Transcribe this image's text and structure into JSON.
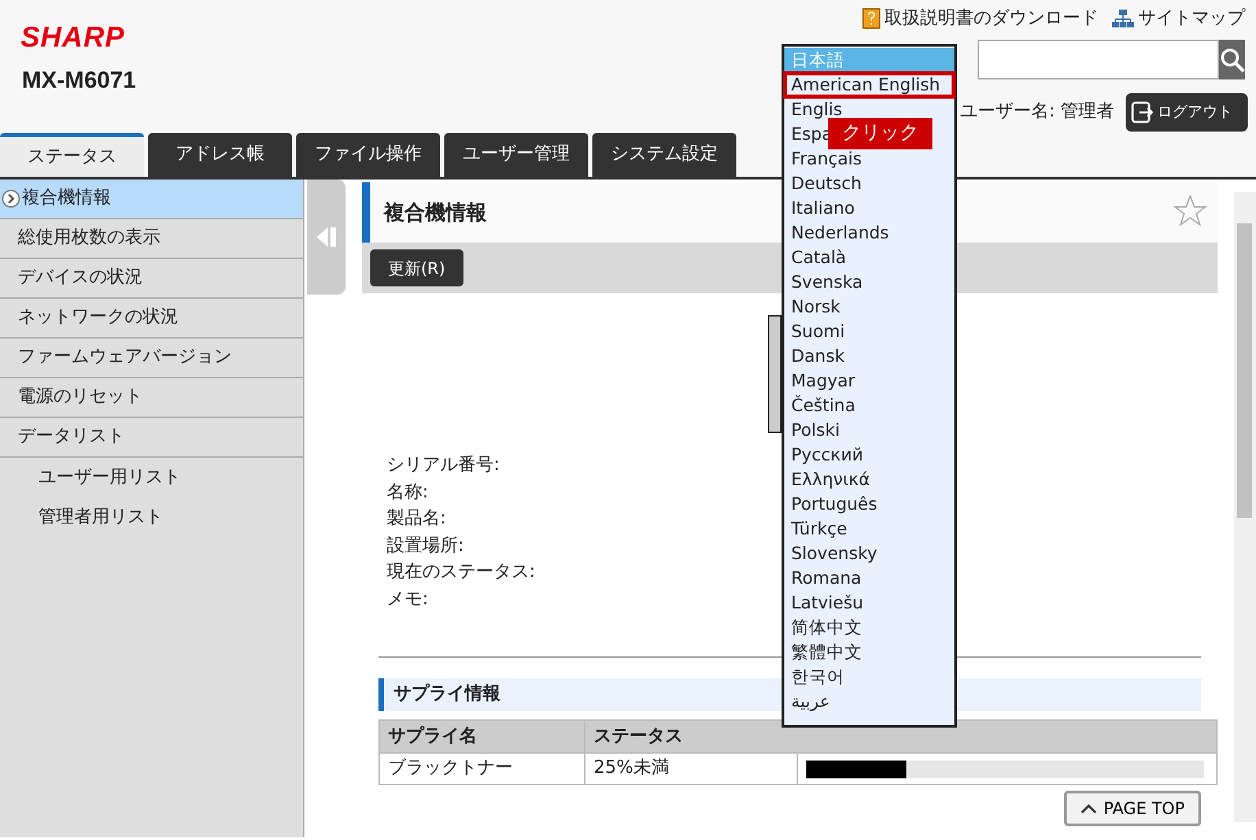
{
  "header": {
    "logo": "SHARP",
    "model": "MX-M6071",
    "links": [
      {
        "kind": "manual",
        "label": "取扱説明書のダウンロード"
      },
      {
        "kind": "sitemap",
        "label": "サイトマップ"
      }
    ],
    "user": "ユーザー名: 管理者",
    "logout": "ログアウト"
  },
  "tabs": [
    {
      "label": "ステータス",
      "selected": true
    },
    {
      "label": "アドレス帳",
      "selected": false
    },
    {
      "label": "ファイル操作",
      "selected": false
    },
    {
      "label": "ユーザー管理",
      "selected": false
    },
    {
      "label": "システム設定",
      "selected": false
    }
  ],
  "sidebar": {
    "items": [
      {
        "label": "複合機情報",
        "selected": true
      },
      {
        "label": "総使用枚数の表示",
        "selected": false
      },
      {
        "label": "デバイスの状況",
        "selected": false
      },
      {
        "label": "ネットワークの状況",
        "selected": false
      },
      {
        "label": "ファームウェアバージョン",
        "selected": false
      },
      {
        "label": "電源のリセット",
        "selected": false
      },
      {
        "label": "データリスト",
        "selected": false,
        "children": [
          {
            "label": "ユーザー用リスト",
            "selected": false
          },
          {
            "label": "管理者用リスト",
            "selected": false
          }
        ]
      }
    ]
  },
  "main": {
    "title": "複合機情報",
    "refresh_button": "更新(R)",
    "fields": [
      {
        "label": "シリアル番号:"
      },
      {
        "label": "名称:"
      },
      {
        "label": "製品名:"
      },
      {
        "label": "設置場所:"
      },
      {
        "label": "現在のステータス:"
      },
      {
        "label": "メモ:"
      }
    ],
    "supply": {
      "title": "サプライ情報",
      "columns": [
        "サプライ名",
        "ステータス"
      ],
      "rows": [
        {
          "name": "ブラックトナー",
          "status": "25%未満",
          "level": 0.25
        }
      ]
    },
    "page_top": "PAGE TOP"
  },
  "language_menu": {
    "items": [
      {
        "label": "日本語",
        "selected": true,
        "highlighted": false
      },
      {
        "label": "American English",
        "selected": false,
        "highlighted": true
      },
      {
        "label": "Englis",
        "selected": false,
        "highlighted": false
      },
      {
        "label": "Espa",
        "selected": false,
        "highlighted": false
      },
      {
        "label": "Français",
        "selected": false,
        "highlighted": false
      },
      {
        "label": "Deutsch",
        "selected": false,
        "highlighted": false
      },
      {
        "label": "Italiano",
        "selected": false,
        "highlighted": false
      },
      {
        "label": "Nederlands",
        "selected": false,
        "highlighted": false
      },
      {
        "label": "Català",
        "selected": false,
        "highlighted": false
      },
      {
        "label": "Svenska",
        "selected": false,
        "highlighted": false
      },
      {
        "label": "Norsk",
        "selected": false,
        "highlighted": false
      },
      {
        "label": "Suomi",
        "selected": false,
        "highlighted": false
      },
      {
        "label": "Dansk",
        "selected": false,
        "highlighted": false
      },
      {
        "label": "Magyar",
        "selected": false,
        "highlighted": false
      },
      {
        "label": "Čeština",
        "selected": false,
        "highlighted": false
      },
      {
        "label": "Polski",
        "selected": false,
        "highlighted": false
      },
      {
        "label": "Русский",
        "selected": false,
        "highlighted": false
      },
      {
        "label": "Ελληνικά",
        "selected": false,
        "highlighted": false
      },
      {
        "label": "Português",
        "selected": false,
        "highlighted": false
      },
      {
        "label": "Türkçe",
        "selected": false,
        "highlighted": false
      },
      {
        "label": "Slovensky",
        "selected": false,
        "highlighted": false
      },
      {
        "label": "Romana",
        "selected": false,
        "highlighted": false
      },
      {
        "label": "Latviešu",
        "selected": false,
        "highlighted": false
      },
      {
        "label": "简体中文",
        "selected": false,
        "highlighted": false
      },
      {
        "label": "繁體中文",
        "selected": false,
        "highlighted": false
      },
      {
        "label": "한국어",
        "selected": false,
        "highlighted": false
      },
      {
        "label": "عربية",
        "selected": false,
        "highlighted": false
      }
    ],
    "callout": "クリック"
  }
}
